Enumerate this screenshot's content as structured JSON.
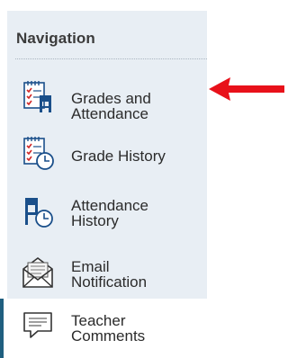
{
  "nav": {
    "heading": "Navigation",
    "items": [
      {
        "label": "Grades and\nAttendance",
        "icon": "grades-attendance-icon"
      },
      {
        "label": "Grade History",
        "icon": "grade-history-icon"
      },
      {
        "label": "Attendance\nHistory",
        "icon": "attendance-history-icon"
      },
      {
        "label": "Email\nNotification",
        "icon": "email-icon"
      },
      {
        "label": "Teacher\nComments",
        "icon": "comment-icon"
      }
    ]
  },
  "annotation": {
    "arrow_color": "#e8111a",
    "arrow_icon": "red-arrow-icon"
  },
  "colors": {
    "panel_bg": "#e8eef4",
    "active_accent": "#1f5f7f",
    "icon_blue": "#1a4f8a",
    "icon_red": "#d02727"
  }
}
